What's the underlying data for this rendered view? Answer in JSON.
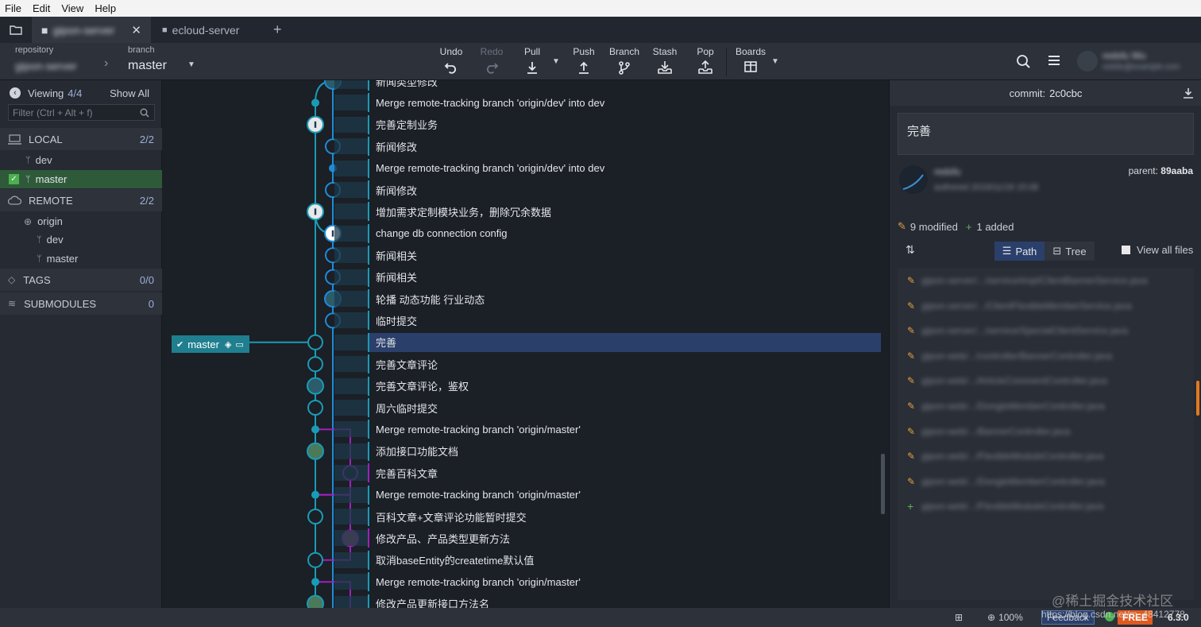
{
  "menu": [
    "File",
    "Edit",
    "View",
    "Help"
  ],
  "tabs": {
    "active": "gipon-server",
    "other": "ecloud-server",
    "add": "+"
  },
  "toolbar": {
    "repo_label": "repository",
    "repo_value": "gipon-server",
    "branch_label": "branch",
    "branch_value": "master",
    "undo": "Undo",
    "redo": "Redo",
    "pull": "Pull",
    "push": "Push",
    "branch": "Branch",
    "stash": "Stash",
    "pop": "Pop",
    "boards": "Boards",
    "user_name": "redsfu Wu",
    "user_email": "redsfu@example.com"
  },
  "sidebar": {
    "viewing": "Viewing",
    "viewing_count": "4/4",
    "show_all": "Show All",
    "filter_placeholder": "Filter (Ctrl + Alt + f)",
    "local": "LOCAL",
    "local_count": "2/2",
    "local_items": [
      "dev",
      "master"
    ],
    "remote": "REMOTE",
    "remote_count": "2/2",
    "remote_origin": "origin",
    "remote_items": [
      "dev",
      "master"
    ],
    "tags": "TAGS",
    "tags_count": "0/0",
    "submodules": "SUBMODULES",
    "submodules_count": "0"
  },
  "commits": [
    "新闻类型修改",
    "Merge remote-tracking branch 'origin/dev' into dev",
    "完善定制业务",
    "新闻修改",
    "Merge remote-tracking branch 'origin/dev' into dev",
    "新闻修改",
    "增加需求定制模块业务，删除冗余数据",
    "change db connection config",
    "新闻相关",
    "新闻相关",
    "轮播 动态功能 行业动态",
    "临时提交",
    "完善",
    "完善文章评论",
    "完善文章评论，鉴权",
    "周六临时提交",
    "Merge remote-tracking branch 'origin/master'",
    "添加接口功能文档",
    "完善百科文章",
    "Merge remote-tracking branch 'origin/master'",
    "百科文章+文章评论功能暂时提交",
    "修改产品、产品类型更新方法",
    "取消baseEntity的createtime默认值",
    "Merge remote-tracking branch 'origin/master'",
    "修改产品更新接口方法名"
  ],
  "branch_tag": "master",
  "detail": {
    "commit_label": "commit:",
    "commit_hash": "2c0cbc",
    "message": "完善",
    "author": "redsfu",
    "author_date": "authored 2019/11/18 15:08",
    "parent_label": "parent:",
    "parent_hash": "89aaba",
    "modified": "9 modified",
    "added": "1 added",
    "path": "Path",
    "tree": "Tree",
    "view_all": "View all files",
    "files": [
      {
        "kind": "modified",
        "path": "gipon-server/.../service/impl/ClientBannerService.java"
      },
      {
        "kind": "modified",
        "path": "gipon-server/.../ClientFlexibleMemberService.java"
      },
      {
        "kind": "modified",
        "path": "gipon-server/.../service/SpecialClientService.java"
      },
      {
        "kind": "modified",
        "path": "gipon-web/.../controller/BannerController.java"
      },
      {
        "kind": "modified",
        "path": "gipon-web/.../ArticleCommentController.java"
      },
      {
        "kind": "modified",
        "path": "gipon-web/.../DongleMemberController.java"
      },
      {
        "kind": "modified",
        "path": "gipon-web/.../BannerController.java"
      },
      {
        "kind": "modified",
        "path": "gipon-web/.../FlexibleModuleController.java"
      },
      {
        "kind": "modified",
        "path": "gipon-web/.../DongleMemberController.java"
      },
      {
        "kind": "added",
        "path": "gipon-web/.../FlexibleModuleController.java"
      }
    ]
  },
  "status": {
    "zoom": "100%",
    "feedback": "Feedback",
    "free": "FREE",
    "version": "6.3.0",
    "watermark": "@稀土掘金技术社区",
    "url_overlay": "https://blog.csdn.net/m_48412778"
  },
  "colors": {
    "accent": "#1f8bd6",
    "selected": "#2b3f6b",
    "branch_teal": "#1a9bb5",
    "purple": "#a020c0"
  }
}
